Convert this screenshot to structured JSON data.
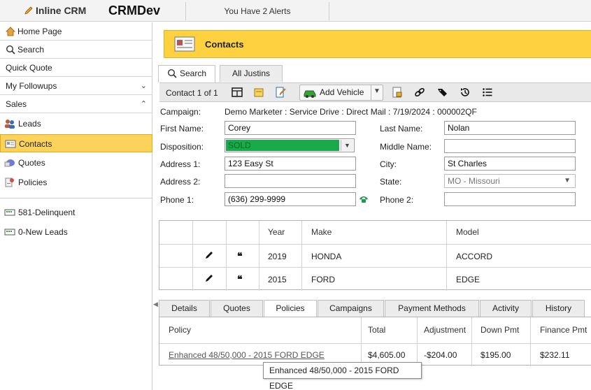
{
  "topbar": {
    "logo": "Inline CRM",
    "app_name": "CRMDev",
    "alerts": "You Have 2 Alerts"
  },
  "sidebar": {
    "home": "Home Page",
    "search": "Search",
    "quick_quote": "Quick Quote",
    "followups": "My Followups",
    "sales": "Sales",
    "items": [
      {
        "label": "Leads",
        "icon": "people-icon"
      },
      {
        "label": "Contacts",
        "icon": "contact-card-icon"
      },
      {
        "label": "Quotes",
        "icon": "quotes-icon"
      },
      {
        "label": "Policies",
        "icon": "policies-icon"
      }
    ],
    "lists": [
      {
        "label": "581-Delinquent",
        "icon": "list-icon"
      },
      {
        "label": "0-New Leads",
        "icon": "list-icon"
      }
    ]
  },
  "banner": {
    "title": "Contacts"
  },
  "tabs": {
    "search": "Search",
    "all": "All Justins"
  },
  "toolbar": {
    "record_nav": "Contact 1 of 1",
    "add_vehicle": "Add Vehicle"
  },
  "form": {
    "campaign_label": "Campaign:",
    "campaign_value": "Demo Marketer : Service Drive : Direct Mail : 7/19/2024 : 000002QF",
    "first_name_label": "First Name:",
    "first_name": "Corey",
    "last_name_label": "Last Name:",
    "last_name": "Nolan",
    "disposition_label": "Disposition:",
    "disposition": "SOLD",
    "middle_name_label": "Middle Name:",
    "middle_name": "",
    "address1_label": "Address 1:",
    "address1": "123 Easy St",
    "city_label": "City:",
    "city": "St Charles",
    "address2_label": "Address 2:",
    "address2": "",
    "state_label": "State:",
    "state": "MO - Missouri",
    "phone1_label": "Phone 1:",
    "phone1": "(636) 299-9999",
    "phone2_label": "Phone 2:",
    "phone2": ""
  },
  "vehicles": {
    "headers": {
      "year": "Year",
      "make": "Make",
      "model": "Model"
    },
    "rows": [
      {
        "year": "2019",
        "make": "HONDA",
        "model": "ACCORD"
      },
      {
        "year": "2015",
        "make": "FORD",
        "model": "EDGE"
      }
    ]
  },
  "bottom_tabs": [
    "Details",
    "Quotes",
    "Policies",
    "Campaigns",
    "Payment Methods",
    "Activity",
    "History"
  ],
  "policies": {
    "headers": {
      "policy": "Policy",
      "total": "Total",
      "adjustment": "Adjustment",
      "down": "Down Pmt",
      "finance": "Finance Pmt"
    },
    "rows": [
      {
        "policy": "Enhanced 48/50,000 - 2015 FORD EDGE",
        "total": "$4,605.00",
        "adjustment": "-$204.00",
        "down": "$195.00",
        "finance": "$232.11"
      }
    ]
  },
  "tooltip": "Enhanced 48/50,000 - 2015 FORD EDGE",
  "colors": {
    "accent": "#fdd13f",
    "sold": "#1aaa4b"
  }
}
